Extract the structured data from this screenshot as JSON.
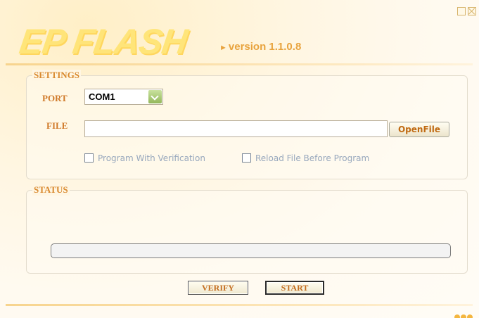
{
  "app": {
    "logo_text": "EP FLASH",
    "version": "version 1.1.0.8"
  },
  "settings": {
    "title": "SETTINGS",
    "port_label": "PORT",
    "port_value": "COM1",
    "file_label": "FILE",
    "file_value": "",
    "open_file_label": "OpenFile",
    "options": [
      {
        "label": "Program With Verification",
        "checked": false
      },
      {
        "label": "Reload File Before Program",
        "checked": false
      }
    ]
  },
  "status": {
    "title": "STATUS",
    "progress_percent": 0
  },
  "actions": {
    "verify_label": "VERIFY",
    "start_label": "START"
  },
  "colors": {
    "accent": "#e8a33d",
    "label": "#d07a2a",
    "progress": "#6ca943"
  },
  "icons": {
    "minimize": "minimize-icon",
    "close": "close-icon",
    "dropdown": "chevron-down-icon",
    "version_arrow": "arrow-right-icon"
  }
}
